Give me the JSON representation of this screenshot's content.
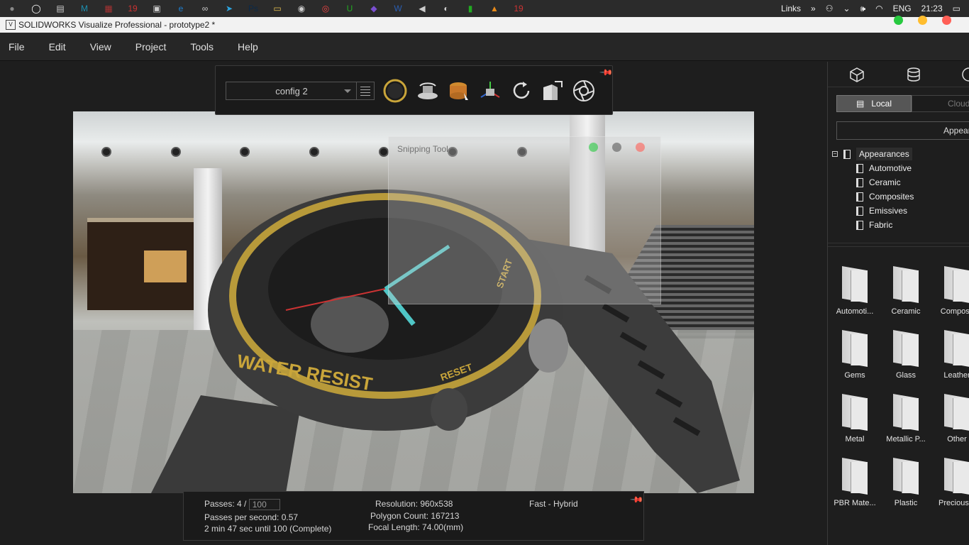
{
  "taskbar": {
    "icons": [
      "apple-icon",
      "circle-icon",
      "window-icon",
      "m-app-icon",
      "rar-icon",
      "app-2019-icon",
      "store-icon",
      "edge-icon",
      "infinity-icon",
      "telegram-icon",
      "photoshop-icon",
      "folder-icon",
      "steam-icon",
      "chrome-icon",
      "u-app-icon",
      "visual-studio-icon",
      "word-icon",
      "unity-icon",
      "visualize-icon",
      "green-app-icon",
      "vlc-icon",
      "app-2019b-icon"
    ],
    "links_label": "Links",
    "language": "ENG",
    "time": "21:23"
  },
  "window": {
    "title": "SOLIDWORKS Visualize Professional - prototype2 *"
  },
  "menu": [
    "File",
    "Edit",
    "View",
    "Project",
    "Tools",
    "Help"
  ],
  "toolbar": {
    "config_value": "config 2",
    "tools": [
      "render-mode-icon",
      "turntable-icon",
      "appearance-paint-icon",
      "transform-axes-icon",
      "refresh-icon",
      "export-view-icon",
      "aperture-icon"
    ]
  },
  "snipping": {
    "title": "Snipping Tool"
  },
  "status": {
    "passes_label": "Passes: 4 /",
    "passes_target": "100",
    "passes_per_second": "Passes per second: 0.57",
    "time_remaining": "2 min 47 sec until 100 (Complete)",
    "resolution": "Resolution: 960x538",
    "polygon_count": "Polygon Count: 167213",
    "focal_length": "Focal Length: 74.00(mm)",
    "render_mode": "Fast - Hybrid"
  },
  "right_panel": {
    "tabs": [
      "model-cube-icon",
      "library-database-icon",
      "palette-icon"
    ],
    "local_label": "Local",
    "cloud_label": "Cloud",
    "appearances_button": "Appear",
    "tree_root": "Appearances",
    "tree_items": [
      "Automotive",
      "Ceramic",
      "Composites",
      "Emissives",
      "Fabric"
    ],
    "tiles": [
      "Automoti...",
      "Ceramic",
      "Composit",
      "Gems",
      "Glass",
      "Leather",
      "Metal",
      "Metallic P...",
      "Other",
      "PBR Mate...",
      "Plastic",
      "Precious..."
    ]
  }
}
